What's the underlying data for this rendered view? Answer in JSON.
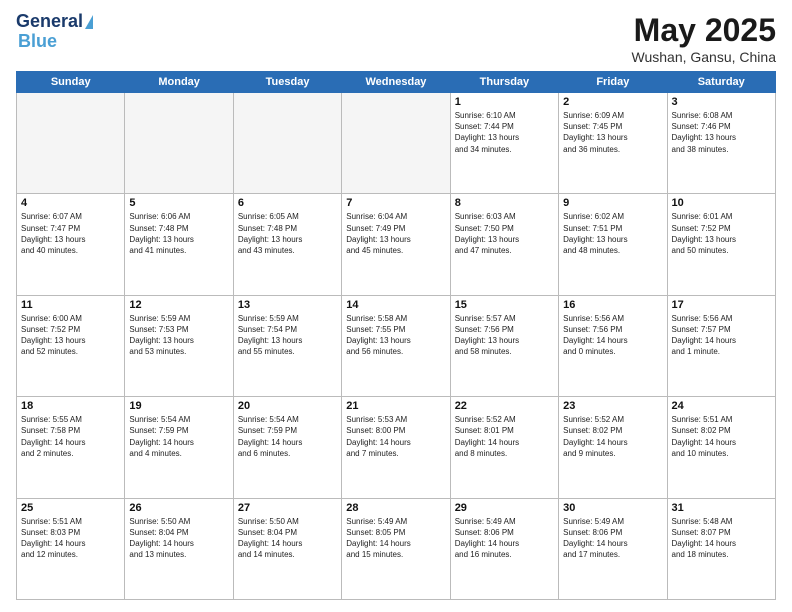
{
  "header": {
    "logo_line1": "General",
    "logo_line2": "Blue",
    "month_year": "May 2025",
    "location": "Wushan, Gansu, China"
  },
  "days_of_week": [
    "Sunday",
    "Monday",
    "Tuesday",
    "Wednesday",
    "Thursday",
    "Friday",
    "Saturday"
  ],
  "weeks": [
    [
      {
        "day": "",
        "text": ""
      },
      {
        "day": "",
        "text": ""
      },
      {
        "day": "",
        "text": ""
      },
      {
        "day": "",
        "text": ""
      },
      {
        "day": "1",
        "text": "Sunrise: 6:10 AM\nSunset: 7:44 PM\nDaylight: 13 hours\nand 34 minutes."
      },
      {
        "day": "2",
        "text": "Sunrise: 6:09 AM\nSunset: 7:45 PM\nDaylight: 13 hours\nand 36 minutes."
      },
      {
        "day": "3",
        "text": "Sunrise: 6:08 AM\nSunset: 7:46 PM\nDaylight: 13 hours\nand 38 minutes."
      }
    ],
    [
      {
        "day": "4",
        "text": "Sunrise: 6:07 AM\nSunset: 7:47 PM\nDaylight: 13 hours\nand 40 minutes."
      },
      {
        "day": "5",
        "text": "Sunrise: 6:06 AM\nSunset: 7:48 PM\nDaylight: 13 hours\nand 41 minutes."
      },
      {
        "day": "6",
        "text": "Sunrise: 6:05 AM\nSunset: 7:48 PM\nDaylight: 13 hours\nand 43 minutes."
      },
      {
        "day": "7",
        "text": "Sunrise: 6:04 AM\nSunset: 7:49 PM\nDaylight: 13 hours\nand 45 minutes."
      },
      {
        "day": "8",
        "text": "Sunrise: 6:03 AM\nSunset: 7:50 PM\nDaylight: 13 hours\nand 47 minutes."
      },
      {
        "day": "9",
        "text": "Sunrise: 6:02 AM\nSunset: 7:51 PM\nDaylight: 13 hours\nand 48 minutes."
      },
      {
        "day": "10",
        "text": "Sunrise: 6:01 AM\nSunset: 7:52 PM\nDaylight: 13 hours\nand 50 minutes."
      }
    ],
    [
      {
        "day": "11",
        "text": "Sunrise: 6:00 AM\nSunset: 7:52 PM\nDaylight: 13 hours\nand 52 minutes."
      },
      {
        "day": "12",
        "text": "Sunrise: 5:59 AM\nSunset: 7:53 PM\nDaylight: 13 hours\nand 53 minutes."
      },
      {
        "day": "13",
        "text": "Sunrise: 5:59 AM\nSunset: 7:54 PM\nDaylight: 13 hours\nand 55 minutes."
      },
      {
        "day": "14",
        "text": "Sunrise: 5:58 AM\nSunset: 7:55 PM\nDaylight: 13 hours\nand 56 minutes."
      },
      {
        "day": "15",
        "text": "Sunrise: 5:57 AM\nSunset: 7:56 PM\nDaylight: 13 hours\nand 58 minutes."
      },
      {
        "day": "16",
        "text": "Sunrise: 5:56 AM\nSunset: 7:56 PM\nDaylight: 14 hours\nand 0 minutes."
      },
      {
        "day": "17",
        "text": "Sunrise: 5:56 AM\nSunset: 7:57 PM\nDaylight: 14 hours\nand 1 minute."
      }
    ],
    [
      {
        "day": "18",
        "text": "Sunrise: 5:55 AM\nSunset: 7:58 PM\nDaylight: 14 hours\nand 2 minutes."
      },
      {
        "day": "19",
        "text": "Sunrise: 5:54 AM\nSunset: 7:59 PM\nDaylight: 14 hours\nand 4 minutes."
      },
      {
        "day": "20",
        "text": "Sunrise: 5:54 AM\nSunset: 7:59 PM\nDaylight: 14 hours\nand 6 minutes."
      },
      {
        "day": "21",
        "text": "Sunrise: 5:53 AM\nSunset: 8:00 PM\nDaylight: 14 hours\nand 7 minutes."
      },
      {
        "day": "22",
        "text": "Sunrise: 5:52 AM\nSunset: 8:01 PM\nDaylight: 14 hours\nand 8 minutes."
      },
      {
        "day": "23",
        "text": "Sunrise: 5:52 AM\nSunset: 8:02 PM\nDaylight: 14 hours\nand 9 minutes."
      },
      {
        "day": "24",
        "text": "Sunrise: 5:51 AM\nSunset: 8:02 PM\nDaylight: 14 hours\nand 10 minutes."
      }
    ],
    [
      {
        "day": "25",
        "text": "Sunrise: 5:51 AM\nSunset: 8:03 PM\nDaylight: 14 hours\nand 12 minutes."
      },
      {
        "day": "26",
        "text": "Sunrise: 5:50 AM\nSunset: 8:04 PM\nDaylight: 14 hours\nand 13 minutes."
      },
      {
        "day": "27",
        "text": "Sunrise: 5:50 AM\nSunset: 8:04 PM\nDaylight: 14 hours\nand 14 minutes."
      },
      {
        "day": "28",
        "text": "Sunrise: 5:49 AM\nSunset: 8:05 PM\nDaylight: 14 hours\nand 15 minutes."
      },
      {
        "day": "29",
        "text": "Sunrise: 5:49 AM\nSunset: 8:06 PM\nDaylight: 14 hours\nand 16 minutes."
      },
      {
        "day": "30",
        "text": "Sunrise: 5:49 AM\nSunset: 8:06 PM\nDaylight: 14 hours\nand 17 minutes."
      },
      {
        "day": "31",
        "text": "Sunrise: 5:48 AM\nSunset: 8:07 PM\nDaylight: 14 hours\nand 18 minutes."
      }
    ]
  ]
}
